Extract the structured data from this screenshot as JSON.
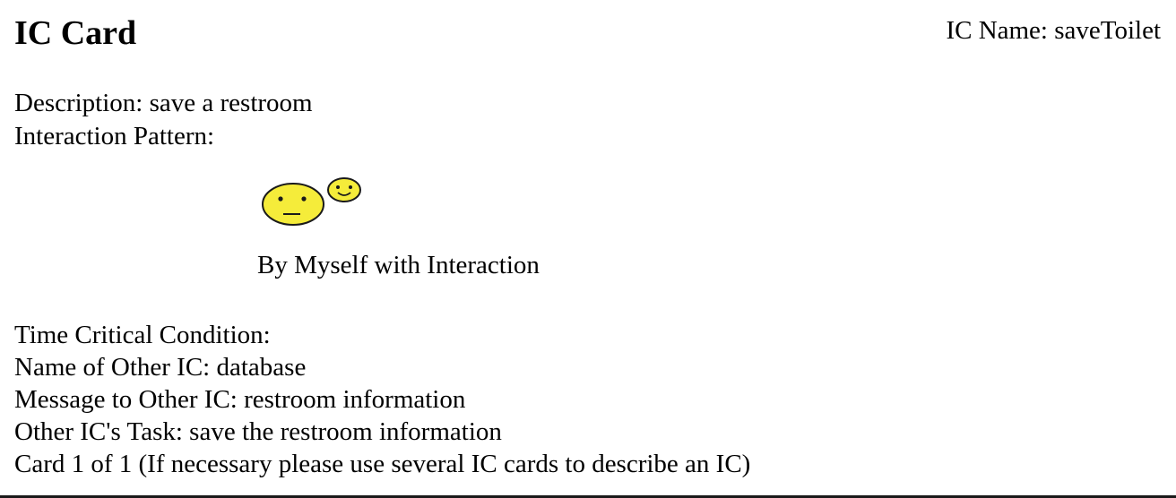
{
  "card": {
    "title": "IC Card",
    "ic_name_line": "IC Name: saveToilet",
    "description_line": "Description: save a restroom",
    "interaction_pattern_line": "Interaction Pattern:",
    "pattern_icon": "two-smiley-faces-icon",
    "pattern_label": "By Myself with Interaction",
    "time_critical_line": "Time Critical Condition:",
    "other_ic_name_line": "Name of Other IC: database",
    "message_line": "Message to Other IC: restroom information",
    "other_task_line": "Other IC's Task: save the restroom information",
    "card_count_line": "Card 1 of 1 (If necessary please use several IC cards to describe an IC)"
  },
  "colors": {
    "face_fill": "#f5ec3a",
    "face_stroke": "#1a1a1a",
    "text": "#000000",
    "background": "#ffffff"
  }
}
